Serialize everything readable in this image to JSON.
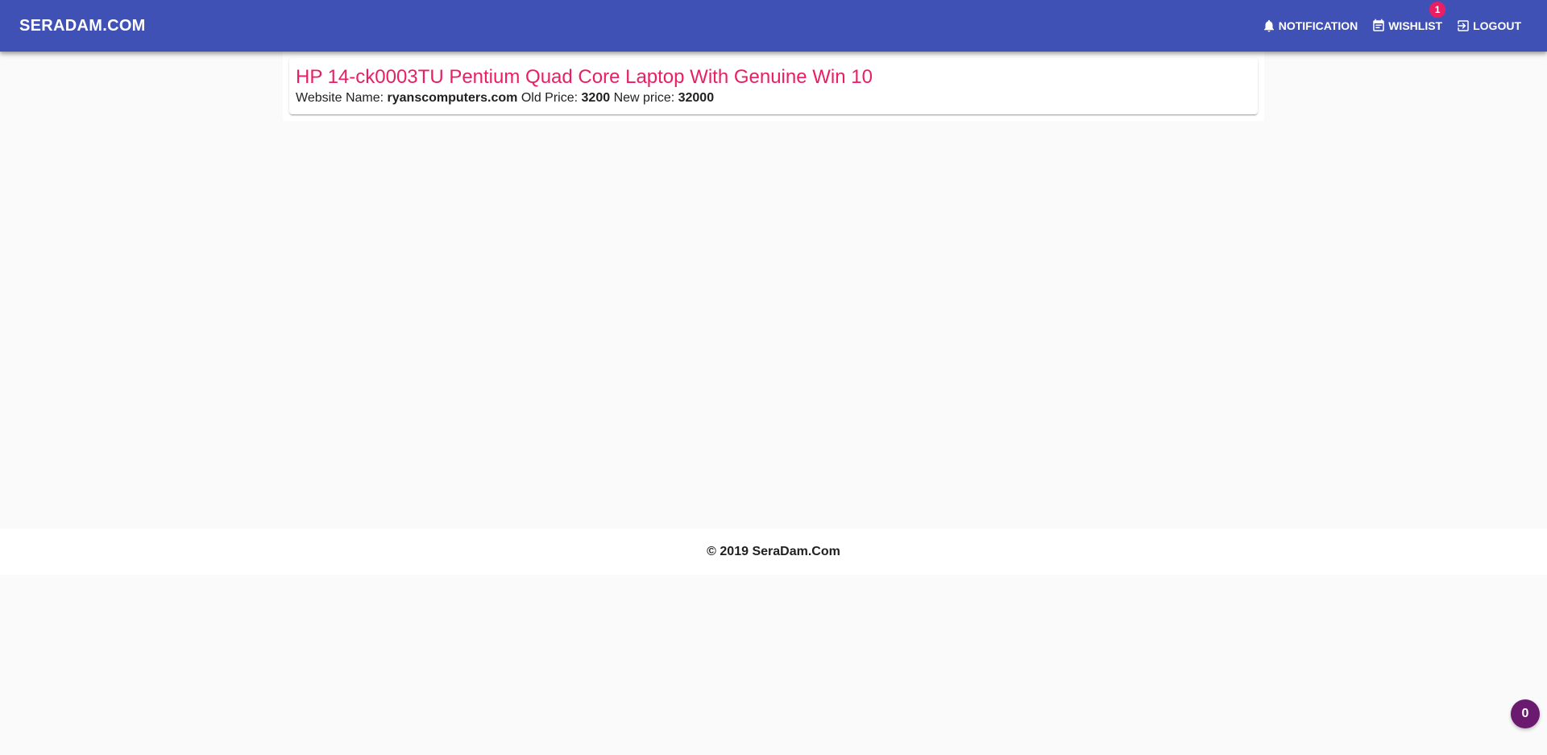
{
  "header": {
    "brand": "SERADAM.COM",
    "nav": [
      {
        "label": "NOTIFICATION",
        "icon": "bell-icon"
      },
      {
        "label": "WISHLIST",
        "icon": "calendar-list-icon",
        "badge": "1"
      },
      {
        "label": "LOGOUT",
        "icon": "logout-icon"
      }
    ]
  },
  "product": {
    "title": "HP 14-ck0003TU Pentium Quad Core Laptop With Genuine Win 10",
    "website_label": "Website Name:",
    "website": "ryanscomputers.com",
    "old_price_label": "Old Price:",
    "old_price": "3200",
    "new_price_label": "New price:",
    "new_price": "32000"
  },
  "footer": {
    "copyright": "© 2019 SeraDam.Com"
  },
  "fab": {
    "count": "0"
  },
  "colors": {
    "toolbar": "#3f51b5",
    "accent": "#e91e63",
    "fab": "#6a1b6f",
    "background": "#fafafa"
  }
}
